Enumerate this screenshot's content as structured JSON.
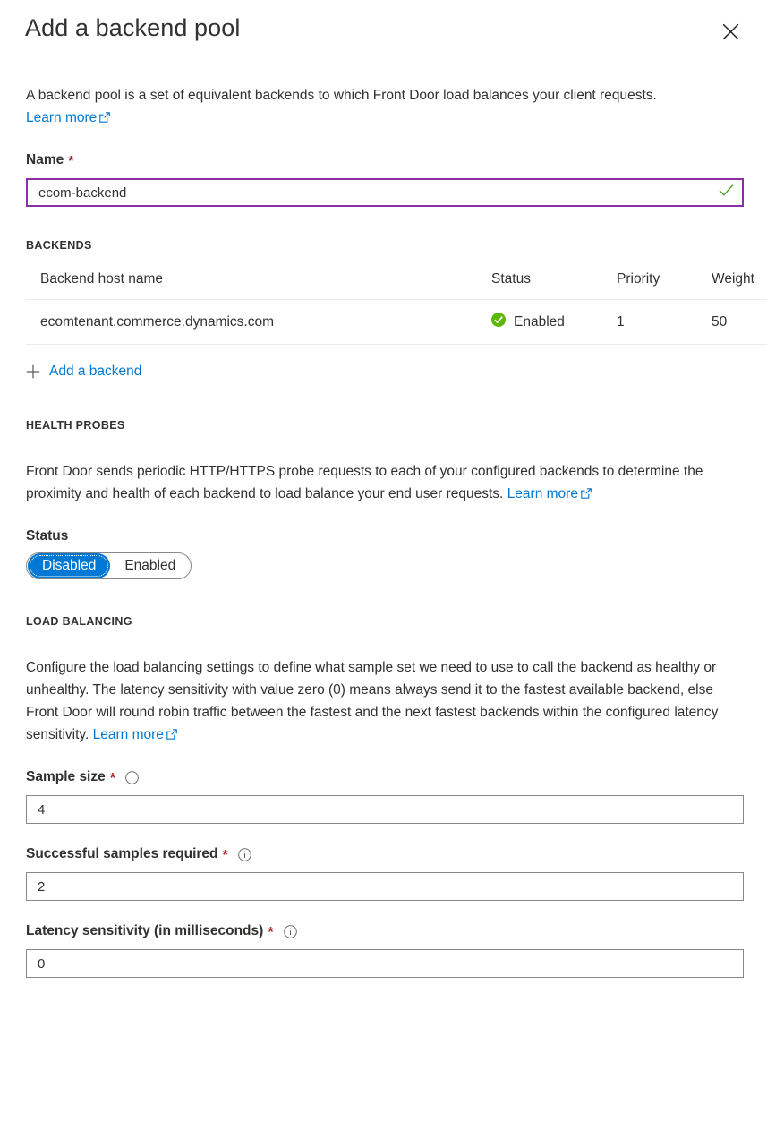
{
  "header": {
    "title": "Add a backend pool",
    "close_icon": "close-icon"
  },
  "intro": {
    "text": "A backend pool is a set of equivalent backends to which Front Door load balances your client requests.",
    "learn_more": "Learn more",
    "external_link_icon": "external-link-icon"
  },
  "name_field": {
    "label": "Name",
    "required_marker": "*",
    "value": "ecom-backend",
    "placeholder": "",
    "valid_icon": "checkmark-icon"
  },
  "backends": {
    "section_title": "BACKENDS",
    "columns": [
      "Backend host name",
      "Status",
      "Priority",
      "Weight"
    ],
    "rows": [
      {
        "host_name": "ecomtenant.commerce.dynamics.com",
        "status": "Enabled",
        "status_icon": "status-enabled-icon",
        "priority": "1",
        "weight": "50"
      }
    ],
    "add_link": "Add a backend",
    "add_icon": "plus-icon"
  },
  "health_probes": {
    "section_title": "HEALTH PROBES",
    "description": "Front Door sends periodic HTTP/HTTPS probe requests to each of your configured backends to determine the proximity and health of each backend to load balance your end user requests.",
    "learn_more": "Learn more",
    "status_label": "Status",
    "toggle": {
      "options": [
        "Disabled",
        "Enabled"
      ],
      "selected": "Disabled"
    }
  },
  "load_balancing": {
    "section_title": "LOAD BALANCING",
    "description": "Configure the load balancing settings to define what sample set we need to use to call the backend as healthy or unhealthy. The latency sensitivity with value zero (0) means always send it to the fastest available backend, else Front Door will round robin traffic between the fastest and the next fastest backends within the configured latency sensitivity.",
    "learn_more": "Learn more",
    "fields": [
      {
        "label": "Sample size",
        "required_marker": "*",
        "info_icon": "info-icon",
        "value": "4",
        "placeholder": ""
      },
      {
        "label": "Successful samples required",
        "required_marker": "*",
        "info_icon": "info-icon",
        "value": "2",
        "placeholder": ""
      },
      {
        "label": "Latency sensitivity (in milliseconds)",
        "required_marker": "*",
        "info_icon": "info-icon",
        "value": "0",
        "placeholder": ""
      }
    ]
  },
  "colors": {
    "accent_blue": "#0078d4",
    "focus_purple": "#8b2fa6",
    "required_red": "#a4262c",
    "status_green": "#5cb700",
    "valid_green": "#4f9b2e",
    "text": "#323130",
    "border_gray": "#8a8886"
  }
}
